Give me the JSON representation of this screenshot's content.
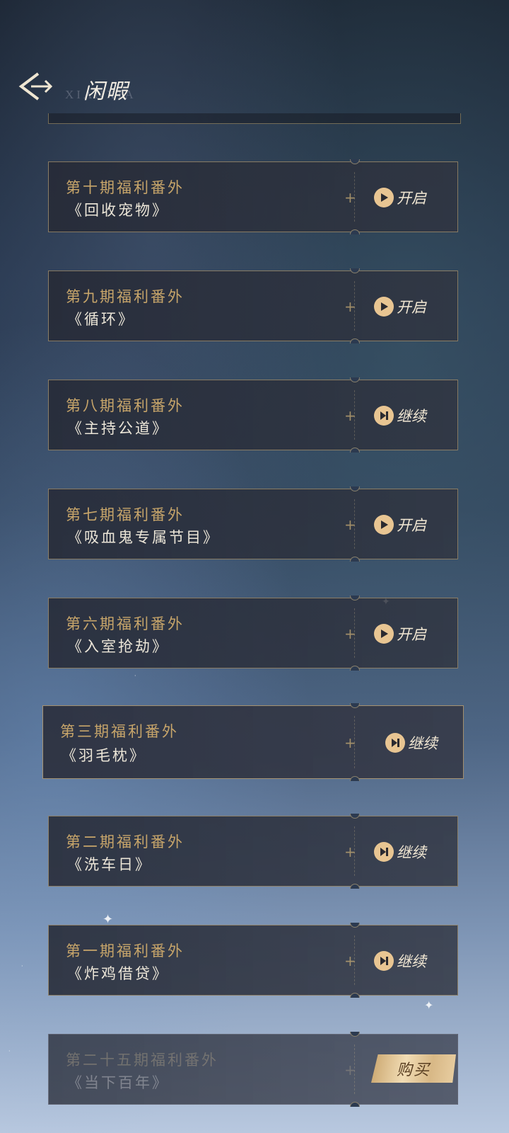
{
  "header": {
    "title": "闲暇",
    "bg_text": "XIANXIA",
    "back_icon": "back-arrow-icon"
  },
  "episodes": [
    {
      "label": "第十期福利番外",
      "title": "《回收宠物》",
      "action": "开启",
      "icon": "play-icon"
    },
    {
      "label": "第九期福利番外",
      "title": "《循环》",
      "action": "开启",
      "icon": "play-icon"
    },
    {
      "label": "第八期福利番外",
      "title": "《主持公道》",
      "action": "继续",
      "icon": "resume-icon"
    },
    {
      "label": "第七期福利番外",
      "title": "《吸血鬼专属节目》",
      "action": "开启",
      "icon": "play-icon"
    },
    {
      "label": "第六期福利番外",
      "title": "《入室抢劫》",
      "action": "开启",
      "icon": "play-icon"
    },
    {
      "label": "第三期福利番外",
      "title": "《羽毛枕》",
      "action": "继续",
      "icon": "resume-icon"
    },
    {
      "label": "第二期福利番外",
      "title": "《洗车日》",
      "action": "继续",
      "icon": "resume-icon"
    },
    {
      "label": "第一期福利番外",
      "title": "《炸鸡借贷》",
      "action": "继续",
      "icon": "resume-icon"
    },
    {
      "label": "第二十五期福利番外",
      "title": "《当下百年》",
      "action": "购买",
      "icon": "buy-icon"
    }
  ],
  "colors": {
    "accent_gold": "#c7a56a",
    "button_gold": "#e8c592",
    "card_border": "#d6b882"
  }
}
